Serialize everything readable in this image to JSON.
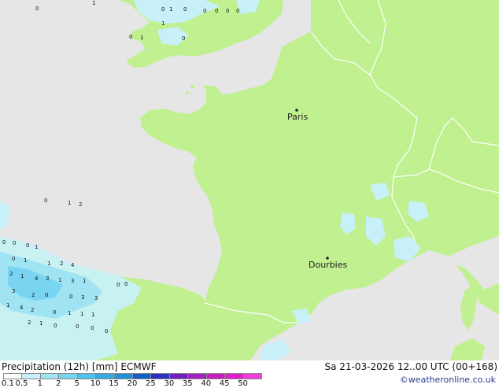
{
  "title": "Precipitation (12h) [mm] ECMWF",
  "timestamp": "Sa 21-03-2026 12..00 UTC (00+168)",
  "credit": "©weatheronline.co.uk",
  "cities": [
    {
      "name": "Paris"
    },
    {
      "name": "Dourbies"
    }
  ],
  "legend": {
    "ticks": [
      "0.1",
      "0.5",
      "1",
      "2",
      "5",
      "10",
      "15",
      "20",
      "25",
      "30",
      "35",
      "40",
      "45",
      "50"
    ],
    "colors": [
      "#ffffff",
      "#c8f0f8",
      "#a0e4f4",
      "#78d4f0",
      "#50c0ec",
      "#38a8e0",
      "#2090d8",
      "#1060c8",
      "#3030c0",
      "#7020c0",
      "#a020c0",
      "#c820c0",
      "#e020c8",
      "#f040d8"
    ]
  },
  "colors": {
    "land": "#c0f090",
    "sea": "#e6e6e6",
    "border": "#ffffff",
    "precip_light": "#c8f0f8",
    "precip_mid": "#a0e4f4",
    "precip_strong": "#78d4f0"
  },
  "map_values": [
    "0",
    "1",
    "0",
    "1",
    "0",
    "0",
    "0",
    "0",
    "0",
    "1",
    "0",
    "1",
    "0",
    "1",
    "0",
    "2",
    "0",
    "0",
    "0",
    "1",
    "0",
    "1",
    "1",
    "2",
    "4",
    "2",
    "1",
    "4",
    "3",
    "1",
    "3",
    "1",
    "3",
    "2",
    "0",
    "0",
    "3",
    "3",
    "1",
    "4",
    "2",
    "0",
    "1",
    "1",
    "1",
    "2",
    "1",
    "0",
    "0",
    "0",
    "0",
    "0",
    "0"
  ]
}
